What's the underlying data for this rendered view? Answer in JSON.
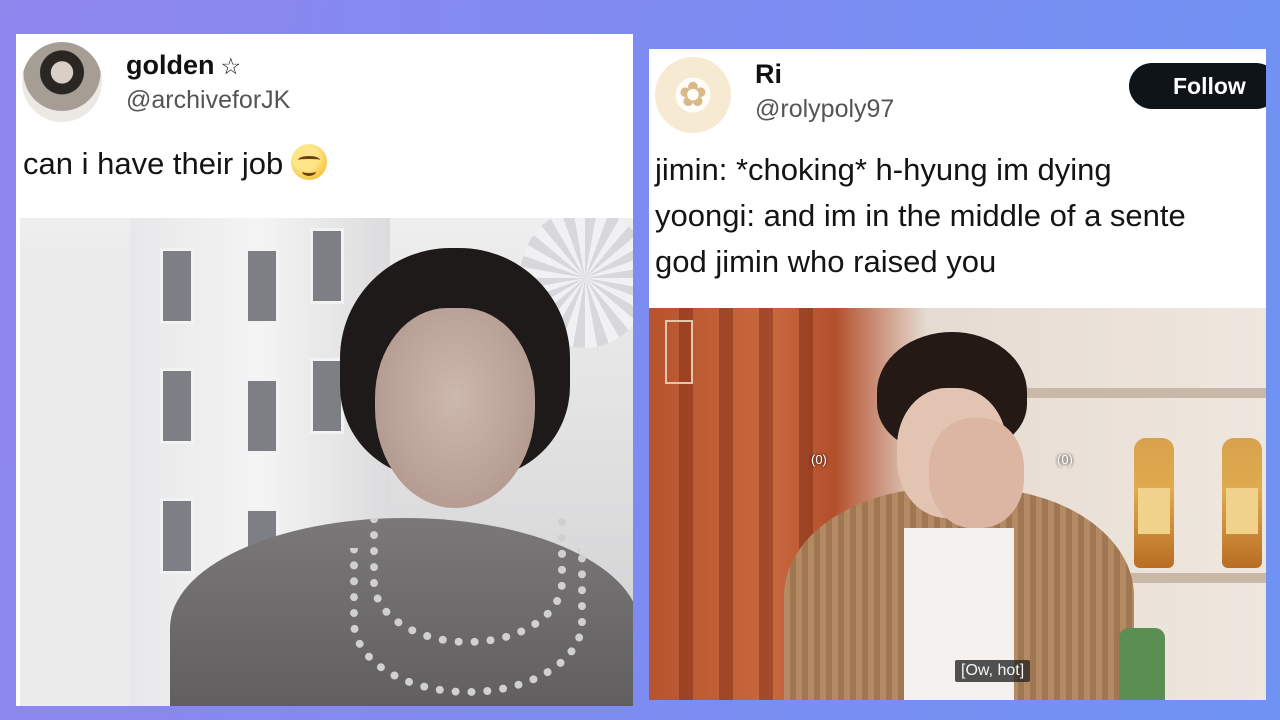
{
  "left_tweet": {
    "display_name": "golden",
    "name_badge": "☆",
    "handle": "@archiveforJK",
    "text": "can i have their job",
    "emoji": "smiling-face-emoji"
  },
  "right_tweet": {
    "display_name": "Ri",
    "handle": "@rolypoly97",
    "follow_label": "Follow",
    "lines": [
      "jimin: *choking* h-hyung im dying",
      "yoongi: and im in the middle of a sente",
      "god jimin who raised you"
    ],
    "video_overlay_left": "(0)",
    "video_overlay_right": "(0)",
    "video_caption": "[Ow, hot]"
  },
  "colors": {
    "background_start": "#8f86ee",
    "background_end": "#6f93f3",
    "follow_button_bg": "#0f1419"
  }
}
